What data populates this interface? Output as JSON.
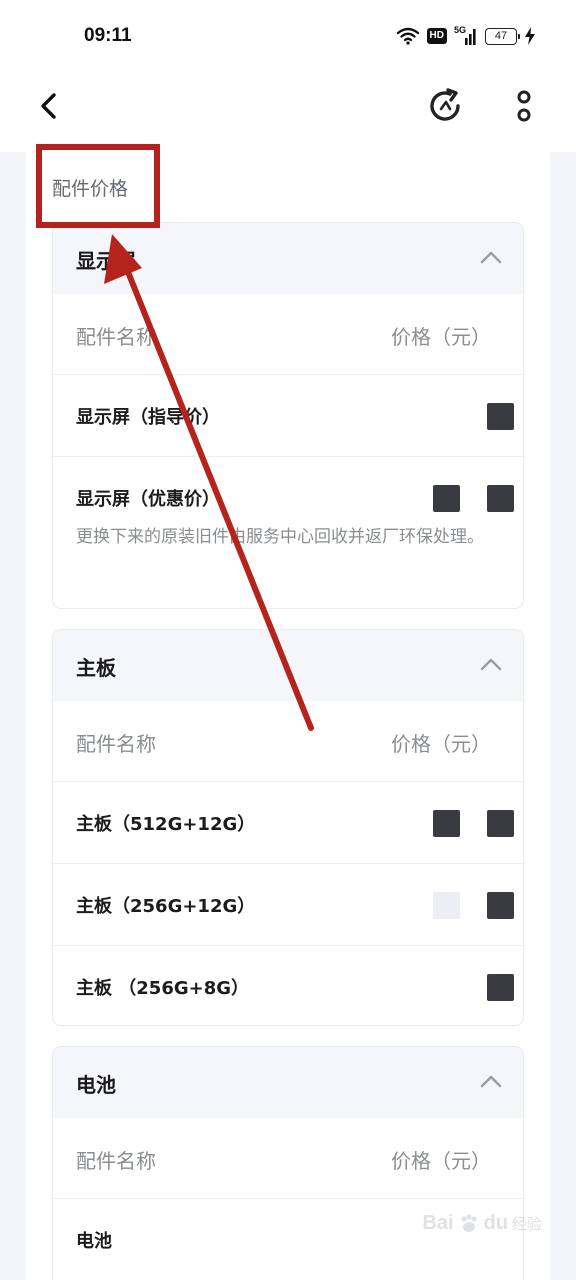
{
  "status_bar": {
    "time": "09:11",
    "hd_label": "HD",
    "network_label": "5G",
    "battery_level": "47"
  },
  "header": {
    "back_icon": "chevron-left-icon",
    "refresh_icon": "refresh-icon",
    "more_icon": "more-vertical-icon"
  },
  "content": {
    "section_title": "配件价格",
    "column_name": "配件名称",
    "column_price": "价格（元）",
    "cards": [
      {
        "title": "显示屏",
        "items": [
          {
            "name": "显示屏（指导价）"
          },
          {
            "name": "显示屏（优惠价）",
            "note": "更换下来的原装旧件由服务中心回收并返厂环保处理。"
          }
        ]
      },
      {
        "title": "主板",
        "items": [
          {
            "name": "主板（512G+12G）"
          },
          {
            "name": "主板（256G+12G）"
          },
          {
            "name": "主板 （256G+8G）"
          }
        ]
      },
      {
        "title": "电池",
        "items": [
          {
            "name": "电池"
          }
        ]
      }
    ]
  },
  "watermark": {
    "brand": "Bai",
    "brand_suffix": "du",
    "sub": "经验"
  },
  "colors": {
    "annotation": "#b5241c",
    "header_bg": "#f5f6f9",
    "muted_text": "#8a8d92"
  }
}
